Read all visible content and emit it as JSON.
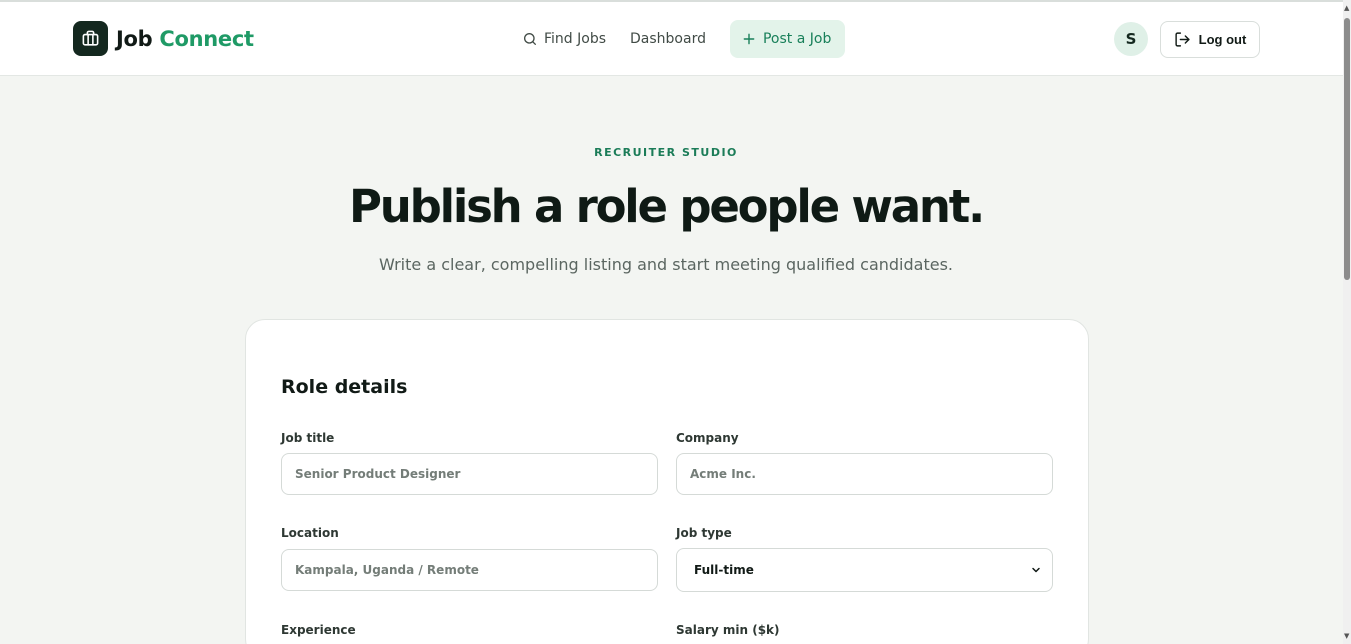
{
  "app": {
    "brand_word1": "Job",
    "brand_word2": "Connect"
  },
  "nav": {
    "find_jobs": "Find Jobs",
    "dashboard": "Dashboard",
    "post_job": "Post a Job"
  },
  "user": {
    "avatar_initial": "S",
    "logout_label": "Log out"
  },
  "hero": {
    "eyebrow": "RECRUITER STUDIO",
    "title": "Publish a role people want.",
    "subtitle": "Write a clear, compelling listing and start meeting qualified candidates."
  },
  "form": {
    "section_title": "Role details",
    "job_title": {
      "label": "Job title",
      "placeholder": "Senior Product Designer"
    },
    "company": {
      "label": "Company",
      "placeholder": "Acme Inc."
    },
    "location": {
      "label": "Location",
      "placeholder": "Kampala, Uganda / Remote"
    },
    "job_type": {
      "label": "Job type",
      "value": "Full-time"
    },
    "experience": {
      "label": "Experience"
    },
    "salary_min": {
      "label": "Salary min ($k)"
    }
  },
  "icons": {
    "logo": "briefcase-icon",
    "find_jobs": "search-icon",
    "post_job": "plus-icon",
    "logout": "logout-icon",
    "select": "chevron-down-icon"
  },
  "colors": {
    "brand_dark": "#14281f",
    "accent": "#1f9a66",
    "accent_soft": "#e3f3ea",
    "page_bg": "#f3f5f2"
  }
}
